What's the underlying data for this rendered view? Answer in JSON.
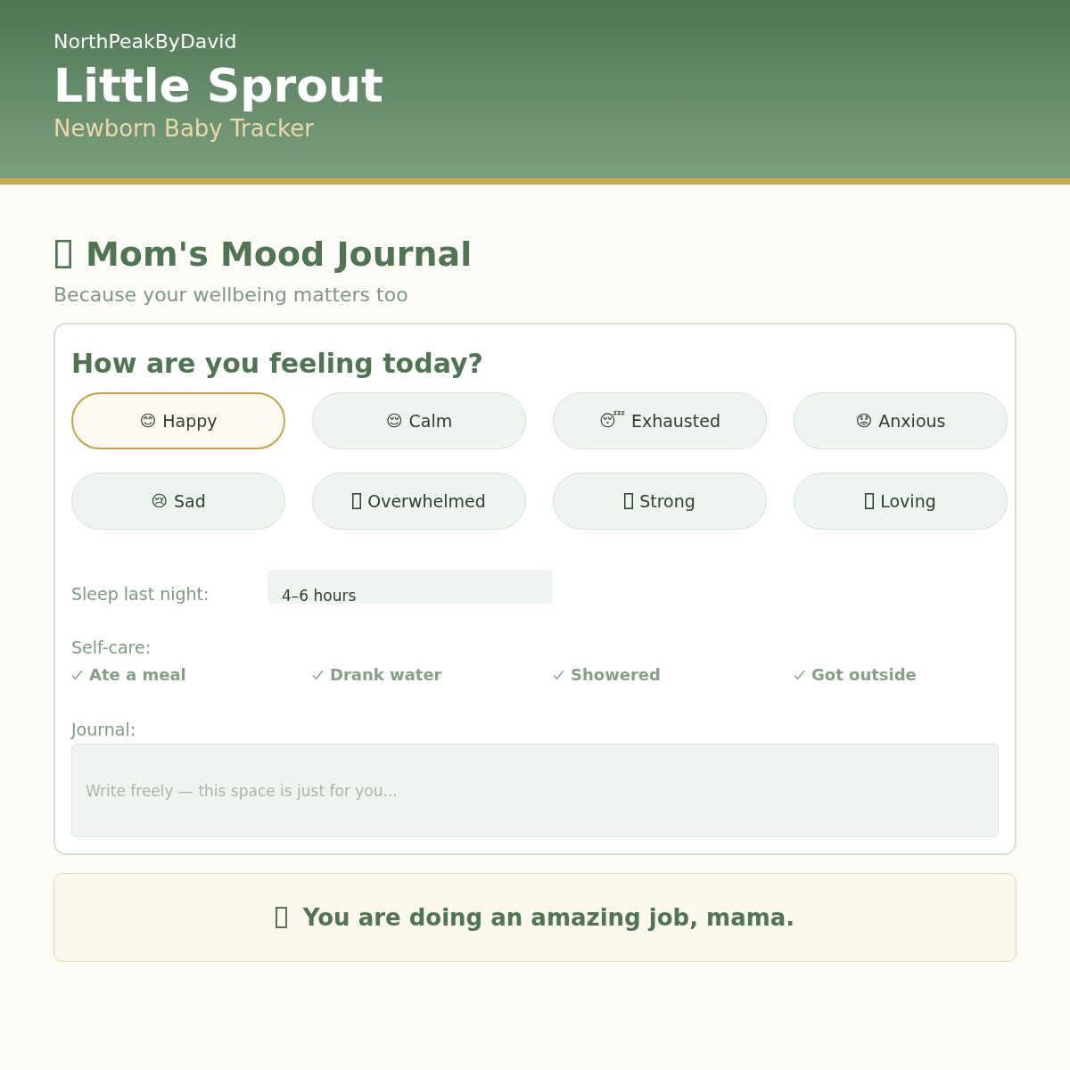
{
  "header": {
    "brand": "NorthPeakByDavid",
    "title": "Little Sprout",
    "subtitle": "Newborn Baby Tracker"
  },
  "section": {
    "title": "Mom's Mood Journal",
    "subtitle": "Because your wellbeing matters too"
  },
  "mood_card": {
    "question": "How are you feeling today?",
    "moods": [
      {
        "icon": "😊",
        "label": "Happy",
        "selected": true
      },
      {
        "icon": "😌",
        "label": "Calm",
        "selected": false
      },
      {
        "icon": "😴",
        "label": "Exhausted",
        "selected": false
      },
      {
        "icon": "😟",
        "label": "Anxious",
        "selected": false
      },
      {
        "icon": "😢",
        "label": "Sad",
        "selected": false
      },
      {
        "label": "Overwhelmed",
        "selected": false
      },
      {
        "label": "Strong",
        "selected": false
      },
      {
        "label": "Loving",
        "selected": false
      }
    ],
    "sleep": {
      "label": "Sleep last night:",
      "value": "4–6 hours"
    },
    "self_care": {
      "label": "Self-care:",
      "items": [
        {
          "label": "Ate a meal",
          "checked": true
        },
        {
          "label": "Drank water",
          "checked": true
        },
        {
          "label": "Showered",
          "checked": true
        },
        {
          "label": "Got outside",
          "checked": true
        }
      ]
    },
    "journal": {
      "label": "Journal:",
      "placeholder": "Write freely — this space is just for you..."
    }
  },
  "encouragement": {
    "text": "You are doing an amazing job, mama."
  }
}
